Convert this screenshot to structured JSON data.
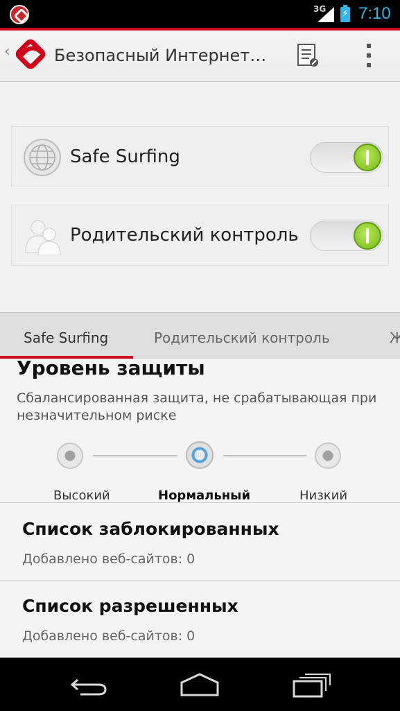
{
  "status_bar": {
    "network": "3G",
    "time": "7:10",
    "accent_color": "#33b5e5"
  },
  "action_bar": {
    "title": "Безопасный Интернет…",
    "brand_color": "#d0021b"
  },
  "toggles": [
    {
      "label": "Safe Surfing",
      "icon": "globe-icon",
      "enabled": true
    },
    {
      "label": "Родительский контроль",
      "icon": "users-icon",
      "enabled": true
    }
  ],
  "tabs": [
    {
      "label": "Safe Surfing",
      "selected": true
    },
    {
      "label": "Родительский контроль",
      "selected": false
    },
    {
      "label": "Ж",
      "selected": false
    }
  ],
  "protection": {
    "title": "Уровень защиты",
    "description": "Сбалансированная защита, не срабатывающая при незначительном риске",
    "levels": [
      {
        "label": "Высокий",
        "selected": false
      },
      {
        "label": "Нормальный",
        "selected": true
      },
      {
        "label": "Низкий",
        "selected": false
      }
    ]
  },
  "lists": [
    {
      "title": "Список заблокированных",
      "subtitle": "Добавлено веб-сайтов: 0"
    },
    {
      "title": "Список разрешенных",
      "subtitle": "Добавлено веб-сайтов: 0"
    }
  ]
}
